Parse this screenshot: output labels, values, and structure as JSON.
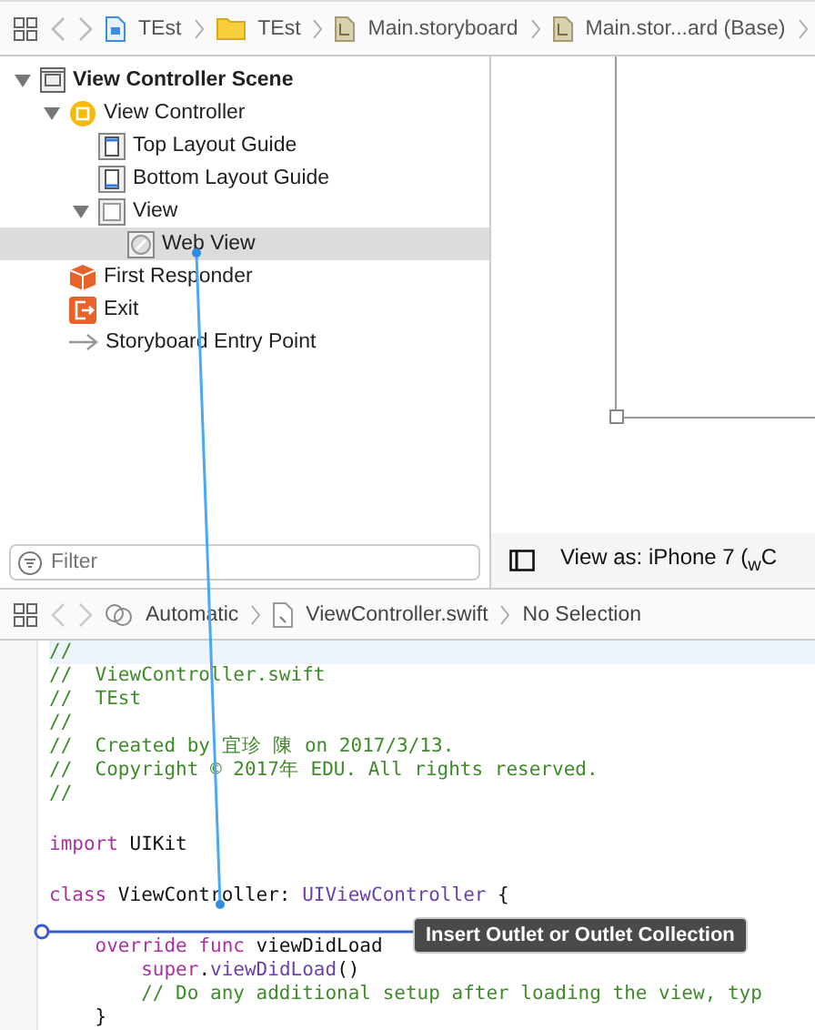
{
  "jump_bar": {
    "crumbs": [
      {
        "label": "TEst",
        "kind": "project"
      },
      {
        "label": "TEst",
        "kind": "folder"
      },
      {
        "label": "Main.storyboard",
        "kind": "storyboard"
      },
      {
        "label": "Main.stor...ard (Base)",
        "kind": "storyboard"
      }
    ]
  },
  "outline": {
    "items": [
      {
        "label": "View Controller Scene",
        "kind": "scene",
        "expanded": true,
        "selected": false,
        "children": [
          {
            "label": "View Controller",
            "kind": "controller",
            "expanded": true,
            "selected": false,
            "children": [
              {
                "label": "Top Layout Guide",
                "kind": "top-guide",
                "selected": false
              },
              {
                "label": "Bottom Layout Guide",
                "kind": "bottom-guide",
                "selected": false
              },
              {
                "label": "View",
                "kind": "view",
                "expanded": true,
                "selected": false,
                "children": [
                  {
                    "label": "Web View",
                    "kind": "webview",
                    "selected": true
                  }
                ]
              }
            ]
          },
          {
            "label": "First Responder",
            "kind": "responder",
            "selected": false
          },
          {
            "label": "Exit",
            "kind": "exit",
            "selected": false
          },
          {
            "label": "Storyboard Entry Point",
            "kind": "entry",
            "selected": false
          }
        ]
      }
    ],
    "filter": {
      "placeholder": "Filter"
    }
  },
  "canvas": {
    "view_as": "View as: iPhone 7 ($_{w}$C"
  },
  "editor_jump_bar": {
    "crumbs": [
      {
        "label": "Automatic",
        "kind": "automatic"
      },
      {
        "label": "ViewController.swift",
        "kind": "swift"
      },
      {
        "label": "No Selection",
        "kind": "plain"
      }
    ]
  },
  "code": {
    "lines": [
      [
        {
          "kind": "comment",
          "text": "//"
        }
      ],
      [
        {
          "kind": "comment",
          "text": "//  ViewController.swift"
        }
      ],
      [
        {
          "kind": "comment",
          "text": "//  TEst"
        }
      ],
      [
        {
          "kind": "comment",
          "text": "//"
        }
      ],
      [
        {
          "kind": "comment",
          "text": "//  Created by 宜珍 陳 on 2017/3/13."
        }
      ],
      [
        {
          "kind": "comment",
          "text": "//  Copyright © 2017年 EDU. All rights reserved."
        }
      ],
      [
        {
          "kind": "comment",
          "text": "//"
        }
      ],
      [
        {
          "kind": "keyword",
          "text": "import",
          "gap_before": true
        },
        {
          "kind": "plain",
          "text": " UIKit"
        }
      ],
      [
        {
          "kind": "keyword",
          "text": "class",
          "gap_before": true
        },
        {
          "kind": "plain",
          "text": " ViewController: "
        },
        {
          "kind": "type",
          "text": "UIViewController"
        },
        {
          "kind": "plain",
          "text": " {"
        }
      ],
      [
        {
          "kind": "keyword",
          "text": "    override func",
          "gap_before": true
        },
        {
          "kind": "plain",
          "text": " viewDidLoad"
        }
      ],
      [
        {
          "kind": "keyword",
          "text": "        super"
        },
        {
          "kind": "plain",
          "text": "."
        },
        {
          "kind": "type",
          "text": "viewDidLoad"
        },
        {
          "kind": "plain",
          "text": "()"
        }
      ],
      [
        {
          "kind": "comment",
          "text": "        // Do any additional setup after loading the view, typ"
        }
      ],
      [
        {
          "kind": "plain",
          "text": "    }"
        }
      ]
    ]
  },
  "tooltip": {
    "text": "Insert Outlet or Outlet Collection"
  }
}
